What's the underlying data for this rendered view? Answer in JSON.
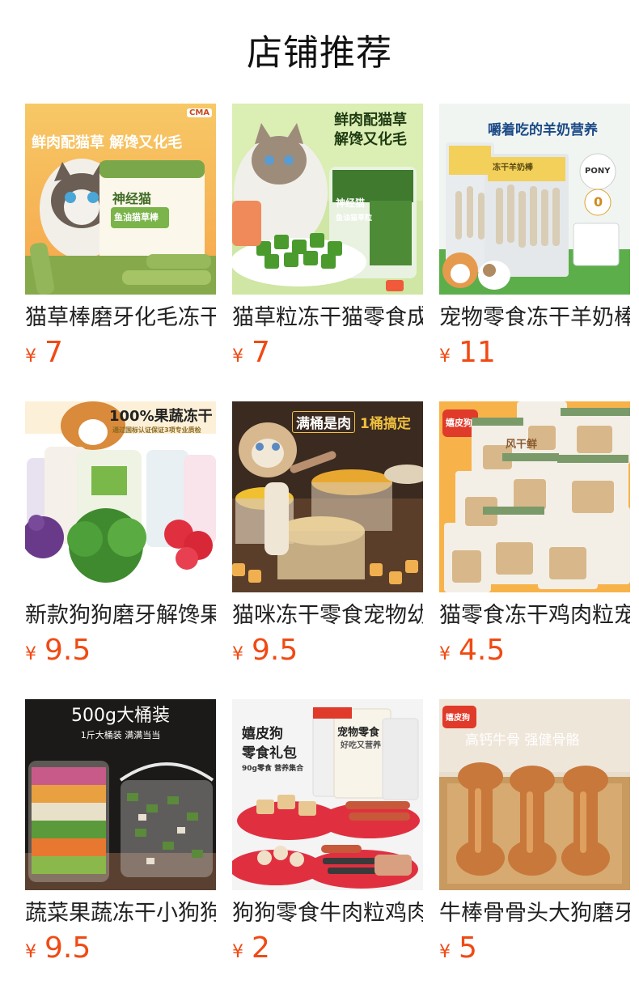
{
  "section_title": "店铺推荐",
  "currency_symbol": "¥",
  "colors": {
    "price": "#f04a14",
    "title": "#111111",
    "name": "#222222"
  },
  "products": [
    {
      "name": "猫草棒磨牙化毛冻干猫",
      "price": "7",
      "image": {
        "icon": "cat-grass-stick-bucket",
        "headline": "鲜肉配猫草 解馋又化毛",
        "brand": "神经猫",
        "sub": "鱼油猫草棒",
        "badge": "CMA"
      }
    },
    {
      "name": "猫草粒冻干猫零食成猫",
      "price": "7",
      "image": {
        "icon": "cat-grass-cubes",
        "headline_1": "鲜肉配猫草",
        "headline_2": "解馋又化毛",
        "brand": "神经猫",
        "sub": "鱼油猫草粒"
      }
    },
    {
      "name": "宠物零食冻干羊奶棒狗",
      "price": "11",
      "image": {
        "icon": "goat-milk-sticks",
        "headline": "嚼着吃的羊奶营养",
        "sub": "冻干羊奶棒",
        "badge_1": "PONY",
        "badge_2": "0"
      }
    },
    {
      "name": "新款狗狗磨牙解馋果蔬",
      "price": "9.5",
      "image": {
        "icon": "fruit-veg-jars",
        "headline": "100%果蔬冻干",
        "sub": "通过国标认证保证3项专业质检"
      }
    },
    {
      "name": "猫咪冻干零食宠物幼猫",
      "price": "9.5",
      "image": {
        "icon": "freeze-dried-meat-tubs",
        "headline_1": "满桶是肉",
        "headline_2": "1桶搞定"
      }
    },
    {
      "name": "猫零食冻干鸡肉粒宠物",
      "price": "4.5",
      "image": {
        "icon": "snack-bags",
        "brand": "嬉皮狗",
        "pack": "风干鲜"
      }
    },
    {
      "name": "蔬菜果蔬冻干小狗狗零",
      "price": "9.5",
      "image": {
        "icon": "veggie-bucket",
        "headline": "500g大桶装",
        "sub": "1斤大桶装 满满当当"
      }
    },
    {
      "name": "狗狗零食牛肉粒鸡肉干",
      "price": "2",
      "image": {
        "icon": "snack-gift-pack",
        "headline_1": "嬉皮狗",
        "headline_2": "零食礼包",
        "sub": "90g零食 营养集合",
        "pack_1": "宠物零食",
        "pack_2": "好吃又营养"
      }
    },
    {
      "name": "牛棒骨骨头大狗磨牙棒",
      "price": "5",
      "image": {
        "icon": "beef-bones",
        "brand": "嬉皮狗",
        "headline": "高钙牛骨 强健骨骼"
      }
    }
  ]
}
